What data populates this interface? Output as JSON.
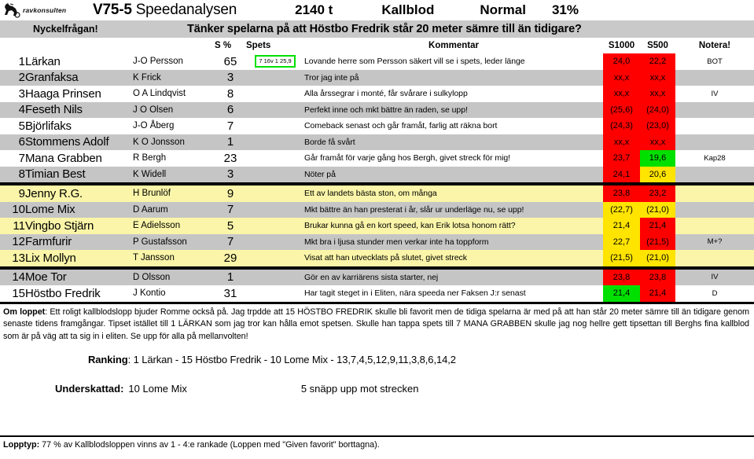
{
  "header": {
    "logo_text": "ravkonsulten",
    "logo_icon": "horse-sulky-icon",
    "race": "V75-5",
    "analysis_name": "Speedanalysen",
    "distance": "2140 t",
    "race_type": "Kallblod",
    "condition": "Normal",
    "percent": "31%"
  },
  "key_question": {
    "label": "Nyckelfrågan!",
    "question": "Tänker spelarna på att Höstbo Fredrik står 20 meter sämre till än tidigare?"
  },
  "table": {
    "columns": {
      "number": "",
      "horse": "",
      "driver": "",
      "sp": "S %",
      "spets": "Spets",
      "kommentar": "Kommentar",
      "s1000": "S1000",
      "s500": "S500",
      "notera": "Notera!"
    },
    "rows": [
      {
        "num": "1",
        "horse": "Lärkan",
        "driver": "J-O Persson",
        "sp": "65",
        "spets": "7 16v 1 25,9",
        "spets_boxed": true,
        "kommentar": "Lovande herre som Persson säkert vill se i spets, leder länge",
        "s1000": "24,0",
        "s1000_color": "red",
        "s500": "22,2",
        "s500_color": "red",
        "notera": "BOT",
        "rowbg": "white"
      },
      {
        "num": "2",
        "horse": "Granfaksa",
        "driver": "K Frick",
        "sp": "3",
        "spets": "",
        "spets_boxed": false,
        "kommentar": "Tror jag inte på",
        "s1000": "xx,x",
        "s1000_color": "red",
        "s500": "xx,x",
        "s500_color": "red",
        "notera": "",
        "rowbg": "gray"
      },
      {
        "num": "3",
        "horse": "Haaga Prinsen",
        "driver": "O A Lindqvist",
        "sp": "8",
        "spets": "",
        "spets_boxed": false,
        "kommentar": "Alla årssegrar i monté, får svårare i sulkylopp",
        "s1000": "xx,x",
        "s1000_color": "red",
        "s500": "xx,x",
        "s500_color": "red",
        "notera": "IV",
        "rowbg": "white"
      },
      {
        "num": "4",
        "horse": "Feseth Nils",
        "driver": "J O Olsen",
        "sp": "6",
        "spets": "",
        "spets_boxed": false,
        "kommentar": "Perfekt inne och mkt bättre än raden, se upp!",
        "s1000": "(25,6)",
        "s1000_color": "red",
        "s500": "(24,0)",
        "s500_color": "red",
        "notera": "",
        "rowbg": "gray"
      },
      {
        "num": "5",
        "horse": "Björlifaks",
        "driver": "J-O Åberg",
        "sp": "7",
        "spets": "",
        "spets_boxed": false,
        "kommentar": "Comeback senast och går framåt, farlig att räkna bort",
        "s1000": "(24,3)",
        "s1000_color": "red",
        "s500": "(23,0)",
        "s500_color": "red",
        "notera": "",
        "rowbg": "white"
      },
      {
        "num": "6",
        "horse": "Stommens Adolf",
        "driver": "K O Jonsson",
        "sp": "1",
        "spets": "",
        "spets_boxed": false,
        "kommentar": "Borde få svårt",
        "s1000": "xx,x",
        "s1000_color": "red",
        "s500": "xx,x",
        "s500_color": "red",
        "notera": "",
        "rowbg": "gray"
      },
      {
        "num": "7",
        "horse": "Mana Grabben",
        "driver": "R Bergh",
        "sp": "23",
        "spets": "",
        "spets_boxed": false,
        "kommentar": "Går framåt för varje gång hos Bergh, givet streck för mig!",
        "s1000": "23,7",
        "s1000_color": "red",
        "s500": "19,6",
        "s500_color": "green",
        "notera": "Kap28",
        "rowbg": "white"
      },
      {
        "num": "8",
        "horse": "Timian Best",
        "driver": "K Widell",
        "sp": "3",
        "spets": "",
        "spets_boxed": false,
        "kommentar": "Nöter på",
        "s1000": "24,1",
        "s1000_color": "red",
        "s500": "20,6",
        "s500_color": "yellow",
        "notera": "",
        "rowbg": "gray"
      },
      {
        "num": "9",
        "horse": "Jenny R.G.",
        "driver": "H Brunlöf",
        "sp": "9",
        "spets": "",
        "spets_boxed": false,
        "kommentar": "Ett av landets bästa ston, om många",
        "s1000": "23,8",
        "s1000_color": "red",
        "s500": "23,2",
        "s500_color": "red",
        "notera": "",
        "rowbg": "yellow"
      },
      {
        "num": "10",
        "horse": "Lome Mix",
        "driver": "D Aarum",
        "sp": "7",
        "spets": "",
        "spets_boxed": false,
        "kommentar": "Mkt bättre än han presterat i år, slår ur underläge nu, se upp!",
        "s1000": "(22,7)",
        "s1000_color": "yellow",
        "s500": "(21,0)",
        "s500_color": "yellow",
        "notera": "",
        "rowbg": "gray"
      },
      {
        "num": "11",
        "horse": "Vingbo Stjärn",
        "driver": "E Adielsson",
        "sp": "5",
        "spets": "",
        "spets_boxed": false,
        "kommentar": "Brukar kunna gå en kort speed, kan Erik lotsa honom rätt?",
        "s1000": "21,4",
        "s1000_color": "yellow",
        "s500": "21,4",
        "s500_color": "red",
        "notera": "",
        "rowbg": "yellow"
      },
      {
        "num": "12",
        "horse": "Farmfurir",
        "driver": "P Gustafsson",
        "sp": "7",
        "spets": "",
        "spets_boxed": false,
        "kommentar": "Mkt bra i ljusa stunder men verkar inte ha toppform",
        "s1000": "22,7",
        "s1000_color": "yellow",
        "s500": "(21,5)",
        "s500_color": "red",
        "notera": "M+?",
        "rowbg": "gray"
      },
      {
        "num": "13",
        "horse": "Lix Mollyn",
        "driver": "T Jansson",
        "sp": "29",
        "spets": "",
        "spets_boxed": false,
        "kommentar": "Visat att han utvecklats på slutet, givet streck",
        "s1000": "(21,5)",
        "s1000_color": "yellow",
        "s500": "(21,0)",
        "s500_color": "yellow",
        "notera": "",
        "rowbg": "yellow"
      },
      {
        "num": "14",
        "horse": "Moe Tor",
        "driver": "D Olsson",
        "sp": "1",
        "spets": "",
        "spets_boxed": false,
        "kommentar": "Gör en av karriärens sista starter, nej",
        "s1000": "23,8",
        "s1000_color": "red",
        "s500": "23,8",
        "s500_color": "red",
        "notera": "IV",
        "rowbg": "gray"
      },
      {
        "num": "15",
        "horse": "Höstbo Fredrik",
        "driver": "J Kontio",
        "sp": "31",
        "spets": "",
        "spets_boxed": false,
        "kommentar": "Har tagit steget in i Eliten, nära speeda ner Faksen J:r senast",
        "s1000": "21,4",
        "s1000_color": "green",
        "s500": "21,4",
        "s500_color": "red",
        "notera": "D",
        "rowbg": "white"
      }
    ],
    "separator_after_rows": [
      8,
      13
    ]
  },
  "om_loppet": {
    "label": "Om loppet",
    "text": ": Ett roligt kallblodslopp bjuder Romme också på. Jag trpdde att 15 HÖSTBO FREDRIK skulle bli favorit men de tidiga spelarna är med på att han står 20 meter sämre till än tidigare genom senaste tidens framgångar. Tipset istället till 1 LÄRKAN som jag tror kan hålla emot spetsen. Skulle han tappa spets till 7 MANA GRABBEN skulle jag nog hellre gett tipsettan till Berghs fina kallblod som är på väg att ta sig in i eliten. Se upp för alla på mellanvolten!"
  },
  "ranking": {
    "label": "Ranking",
    "text": ": 1 Lärkan - 15 Höstbo Fredrik - 10 Lome Mix - 13,7,4,5,12,9,11,3,8,6,14,2"
  },
  "underskattad": {
    "label": "Underskattad:",
    "value": "10 Lome Mix",
    "note": "5 snäpp upp mot strecken"
  },
  "lopptyp": {
    "label": "Lopptyp:",
    "text": " 77 % av Kallblodsloppen vinns av 1 - 4:e rankade (Loppen med \"Given favorit\" borttagna)."
  },
  "colors": {
    "red": "#ff0000",
    "green": "#00e000",
    "yellow": "#ffe400",
    "row_gray": "#c5c5c5",
    "row_yellow": "#faf5a8",
    "banner_gray": "#c9c9c9"
  }
}
